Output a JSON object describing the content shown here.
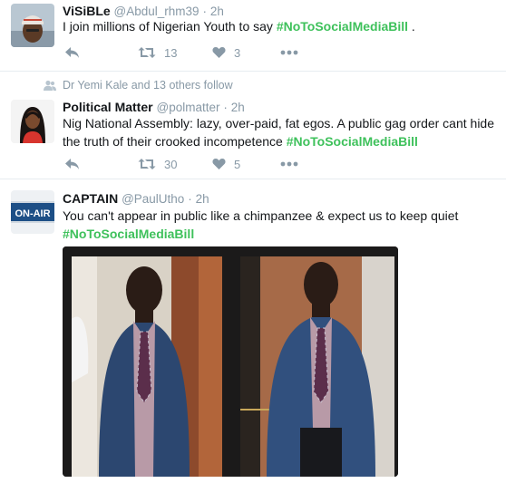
{
  "tweets": [
    {
      "name": "ViSiBLe",
      "handle": "@Abdul_rhm39",
      "sep": "·",
      "time": "2h",
      "text_before": "I join millions of Nigerian Youth to say ",
      "hashtag": "#NoToSocialMediaBill",
      "text_after": " .",
      "retweets": "13",
      "likes": "3"
    },
    {
      "context": "Dr Yemi Kale and 13 others follow",
      "name": "Political Matter",
      "handle": "@polmatter",
      "sep": "·",
      "time": "2h",
      "text_before": "Nig National Assembly: lazy, over-paid, fat egos. A public gag order cant hide the truth of their crooked incompetence ",
      "hashtag": "#NoToSocialMediaBill",
      "retweets": "30",
      "likes": "5"
    },
    {
      "name": "CAPTAIN",
      "handle": "@PaulUtho",
      "sep": "·",
      "time": "2h",
      "text_before": "You can't appear in public like a chimpanzee & expect us to keep quiet",
      "hashtag": "#NoToSocialMediaBill",
      "avatar_text": "ON-AIR"
    }
  ],
  "icons": [
    "reply-icon",
    "retweet-icon",
    "heart-icon",
    "more-icon",
    "follow-context-icon"
  ],
  "colors": {
    "hashtag": "#3ec15b",
    "muted": "#8899a6",
    "divider": "#e6ecf0"
  }
}
